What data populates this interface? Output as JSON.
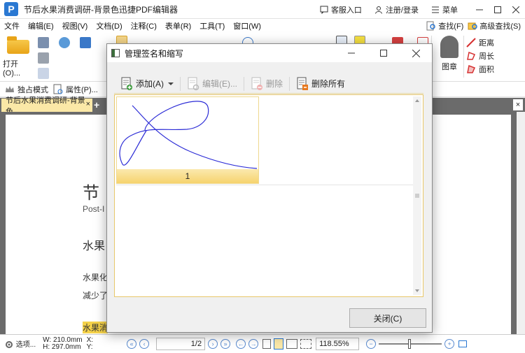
{
  "app": {
    "logo": "P",
    "title": "节后水果消费调研-背景色迅捷PDF编辑器",
    "customer_service": "客服入口",
    "login": "注册/登录",
    "menu": "菜单"
  },
  "menubar": {
    "items": [
      "文件",
      "编辑(E)",
      "视图(V)",
      "文档(D)",
      "注释(C)",
      "表单(R)",
      "工具(T)",
      "窗口(W)"
    ],
    "find": "查找(F)",
    "advanced_find": "高级查找(S)"
  },
  "ribbon": {
    "open": "打开(O)...",
    "zoom_value": "118.55%",
    "seal": "图章",
    "measure": [
      "距离",
      "周长",
      "面积"
    ]
  },
  "toolbar2": {
    "exclusive_mode": "独占模式",
    "properties": "属性(P)..."
  },
  "tabs": {
    "doc_tab": "节后水果消费调研-背景色",
    "close": "×",
    "add": "+"
  },
  "document": {
    "heading_partial": "节",
    "subtitle_partial": "Post-I",
    "section_partial": "水果",
    "para1_partial": "水果化",
    "para2_partial": "减少了",
    "highlight_partial": "水果消"
  },
  "statusbar": {
    "select": "选项...",
    "width": "W: 210.0mm",
    "height": "H: 297.0mm",
    "x": "X:",
    "y": "Y:",
    "page": "1/2",
    "zoom": "118.55%"
  },
  "dialog": {
    "title": "管理签名和缩写",
    "add": "添加(A)",
    "edit": "编辑(E)...",
    "delete": "删除",
    "delete_all": "删除所有",
    "signature_number": "1",
    "close": "关闭(C)"
  },
  "colors": {
    "accent_yellow": "#f6d36e",
    "signature_stroke": "#2b2bd6",
    "app_blue": "#2a78d2"
  }
}
